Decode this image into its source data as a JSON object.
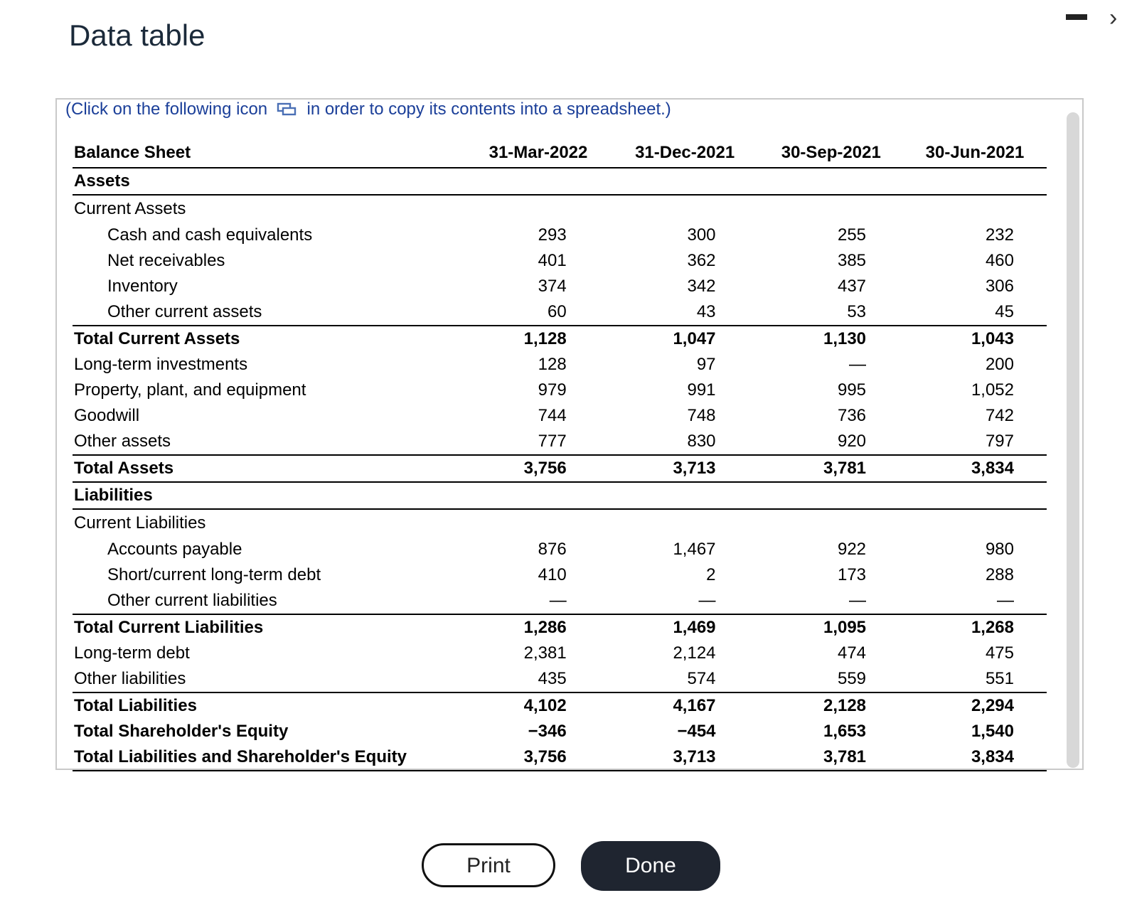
{
  "window": {
    "title": "Data table",
    "minimize_icon": "minimize-icon",
    "close_icon": "close-icon",
    "close_glyph": "›"
  },
  "instruction": {
    "before_icon": "(Click on the following icon",
    "icon": "copy-icon",
    "after_icon": "in order to copy its contents into a spreadsheet.)"
  },
  "table": {
    "header": {
      "label": "Balance Sheet",
      "columns": [
        "31-Mar-2022",
        "31-Dec-2021",
        "30-Sep-2021",
        "30-Jun-2021"
      ]
    },
    "rows": [
      {
        "label": "Assets",
        "style": "section",
        "values": [
          "",
          "",
          "",
          ""
        ]
      },
      {
        "label": "Current Assets",
        "style": "sub",
        "values": [
          "",
          "",
          "",
          ""
        ]
      },
      {
        "label": "Cash and cash equivalents",
        "style": "indent",
        "values": [
          "293",
          "300",
          "255",
          "232"
        ]
      },
      {
        "label": "Net receivables",
        "style": "indent",
        "values": [
          "401",
          "362",
          "385",
          "460"
        ]
      },
      {
        "label": "Inventory",
        "style": "indent",
        "values": [
          "374",
          "342",
          "437",
          "306"
        ]
      },
      {
        "label": "Other current assets",
        "style": "indent line-below",
        "values": [
          "60",
          "43",
          "53",
          "45"
        ]
      },
      {
        "label": "Total Current Assets",
        "style": "bold",
        "values": [
          "1,128",
          "1,047",
          "1,130",
          "1,043"
        ]
      },
      {
        "label": "Long-term investments",
        "style": "",
        "values": [
          "128",
          "97",
          "—",
          "200"
        ]
      },
      {
        "label": "Property, plant, and equipment",
        "style": "",
        "values": [
          "979",
          "991",
          "995",
          "1,052"
        ]
      },
      {
        "label": "Goodwill",
        "style": "",
        "values": [
          "744",
          "748",
          "736",
          "742"
        ]
      },
      {
        "label": "Other assets",
        "style": "line-below",
        "values": [
          "777",
          "830",
          "920",
          "797"
        ]
      },
      {
        "label": "Total Assets",
        "style": "bold line-below",
        "values": [
          "3,756",
          "3,713",
          "3,781",
          "3,834"
        ]
      },
      {
        "label": "Liabilities",
        "style": "section",
        "values": [
          "",
          "",
          "",
          ""
        ]
      },
      {
        "label": "Current Liabilities",
        "style": "sub",
        "values": [
          "",
          "",
          "",
          ""
        ]
      },
      {
        "label": "Accounts payable",
        "style": "indent",
        "values": [
          "876",
          "1,467",
          "922",
          "980"
        ]
      },
      {
        "label": "Short/current long-term debt",
        "style": "indent",
        "values": [
          "410",
          "2",
          "173",
          "288"
        ]
      },
      {
        "label": "Other current liabilities",
        "style": "indent line-below",
        "values": [
          "—",
          "—",
          "—",
          "—"
        ]
      },
      {
        "label": "Total Current Liabilities",
        "style": "bold",
        "values": [
          "1,286",
          "1,469",
          "1,095",
          "1,268"
        ]
      },
      {
        "label": "Long-term debt",
        "style": "",
        "values": [
          "2,381",
          "2,124",
          "474",
          "475"
        ]
      },
      {
        "label": "Other liabilities",
        "style": "line-below",
        "values": [
          "435",
          "574",
          "559",
          "551"
        ]
      },
      {
        "label": "Total Liabilities",
        "style": "bold",
        "values": [
          "4,102",
          "4,167",
          "2,128",
          "2,294"
        ]
      },
      {
        "label": "Total Shareholder's Equity",
        "style": "bold",
        "values": [
          "−346",
          "−454",
          "1,653",
          "1,540"
        ]
      },
      {
        "label": "Total Liabilities and Shareholder's Equity",
        "style": "bold last",
        "values": [
          "3,756",
          "3,713",
          "3,781",
          "3,834"
        ]
      }
    ]
  },
  "buttons": {
    "print_label": "Print",
    "done_label": "Done"
  },
  "colors": {
    "instruction_text": "#1b3f99",
    "done_button_bg": "#1f2530",
    "title_text": "#1b2a3a"
  }
}
